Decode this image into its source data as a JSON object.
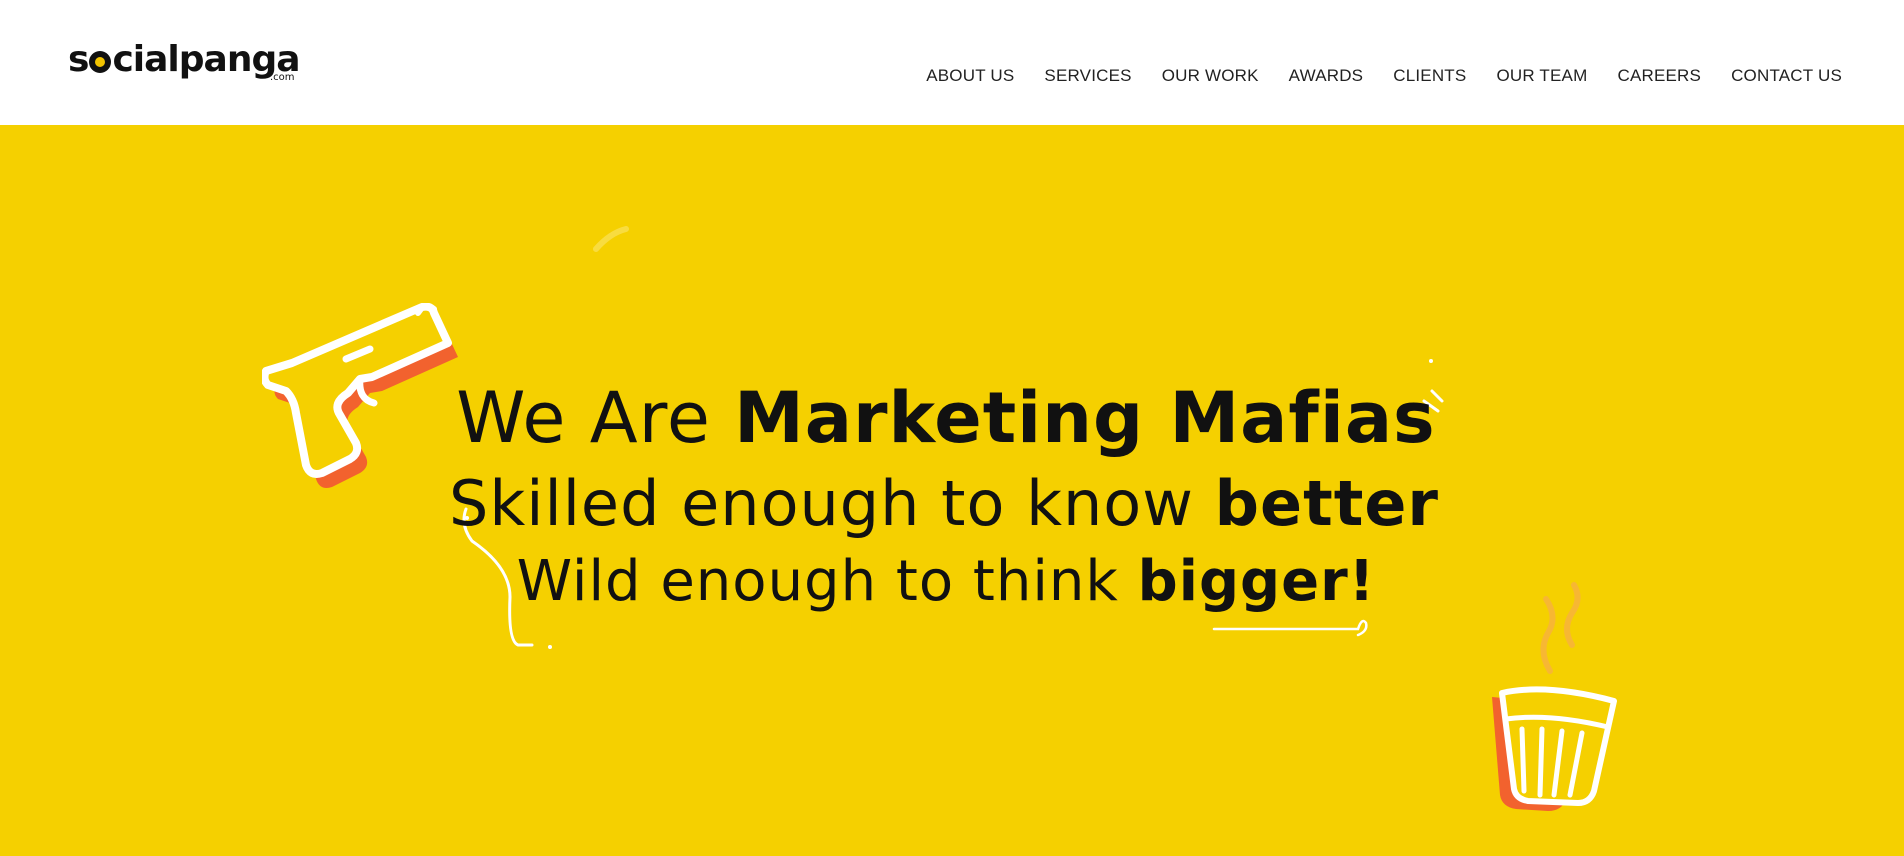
{
  "brand": {
    "logo_text": "socialpanga",
    "logo_suffix": ".com"
  },
  "nav": {
    "items": [
      {
        "label": "ABOUT US"
      },
      {
        "label": "SERVICES"
      },
      {
        "label": "OUR WORK"
      },
      {
        "label": "AWARDS"
      },
      {
        "label": "CLIENTS"
      },
      {
        "label": "OUR TEAM"
      },
      {
        "label": "CAREERS"
      },
      {
        "label": "CONTACT US"
      }
    ]
  },
  "hero": {
    "line1_light": "We Are ",
    "line1_bold": "Marketing Mafias",
    "line2_light": "Skilled enough to know ",
    "line2_bold": "better",
    "line3_light": "Wild enough to think ",
    "line3_bold": "bigger!",
    "icons": [
      "pistol-icon",
      "cutting-chai-glass-icon"
    ]
  },
  "colors": {
    "hero_background": "#f5d000",
    "accent_orange": "#f2622e",
    "text": "#111111",
    "header_background": "#ffffff"
  }
}
